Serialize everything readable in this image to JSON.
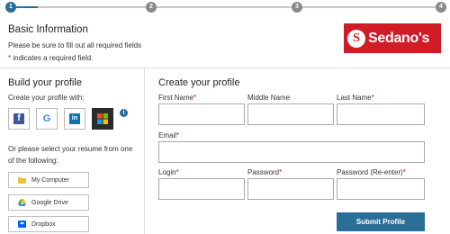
{
  "stepper": {
    "steps": [
      "1",
      "2",
      "3",
      "4"
    ],
    "current_step": 1
  },
  "basic": {
    "title": "Basic Information",
    "note": "Please be sure to fill out all required fields",
    "required_star": "*",
    "required_note": " indicates a required field."
  },
  "logo": {
    "mark": "S",
    "text": "Sedano's",
    "color": "#d11b26"
  },
  "build": {
    "title": "Build your profile",
    "subtitle": "Create your profile with:",
    "social": [
      {
        "icon": "facebook-icon",
        "glyph": "f",
        "bg": "#3b5998"
      },
      {
        "icon": "google-icon",
        "glyph": "G",
        "bg": "#ffffff"
      },
      {
        "icon": "linkedin-icon",
        "glyph": "in",
        "bg": "#0e76a8"
      },
      {
        "icon": "microsoft-icon",
        "glyph": "",
        "bg": "#2b2b2b"
      }
    ],
    "info_glyph": "i",
    "resume_text": "Or please select your resume from one of the following:",
    "sources": [
      {
        "label": "My Computer",
        "icon": "folder-icon"
      },
      {
        "label": "Google Drive",
        "icon": "google-drive-icon"
      },
      {
        "label": "Dropbox",
        "icon": "dropbox-icon"
      }
    ]
  },
  "form": {
    "title": "Create your profile",
    "first_name": "First Name",
    "middle_name": "Middle Name",
    "last_name": "Last Name",
    "email": "Email",
    "login": "Login",
    "password": "Password",
    "password_reenter": "Password (Re-enter)",
    "star": "*",
    "submit": "Submit Profile"
  },
  "colors": {
    "accent": "#2a6f97",
    "required": "#c8102e"
  }
}
